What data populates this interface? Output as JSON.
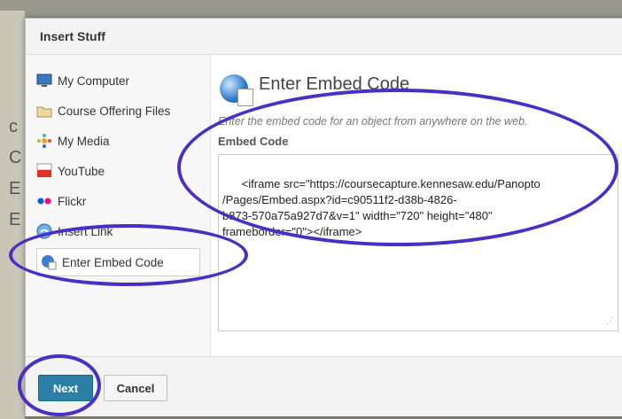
{
  "dialog": {
    "title": "Insert Stuff"
  },
  "sidebar": {
    "items": [
      {
        "label": "My Computer",
        "icon": "computer-icon"
      },
      {
        "label": "Course Offering Files",
        "icon": "folder-icon"
      },
      {
        "label": "My Media",
        "icon": "media-icon"
      },
      {
        "label": "YouTube",
        "icon": "youtube-icon"
      },
      {
        "label": "Flickr",
        "icon": "flickr-icon"
      },
      {
        "label": "Insert Link",
        "icon": "link-icon"
      },
      {
        "label": "Enter Embed Code",
        "icon": "embed-icon",
        "selected": true
      }
    ]
  },
  "main": {
    "heading": "Enter Embed Code",
    "description": "Enter the embed code for an object from anywhere on the web.",
    "field_label": "Embed Code",
    "embed_code": "<iframe src=\"https://coursecapture.kennesaw.edu/Panopto\n/Pages/Embed.aspx?id=c90511f2-d38b-4826-\nb873-570a75a927d7&v=1\" width=\"720\" height=\"480\"\nframeborder=\"0\"></iframe>"
  },
  "footer": {
    "next_label": "Next",
    "cancel_label": "Cancel"
  },
  "colors": {
    "accent": "#2b7fa5",
    "annotation": "#4b2fc4"
  }
}
